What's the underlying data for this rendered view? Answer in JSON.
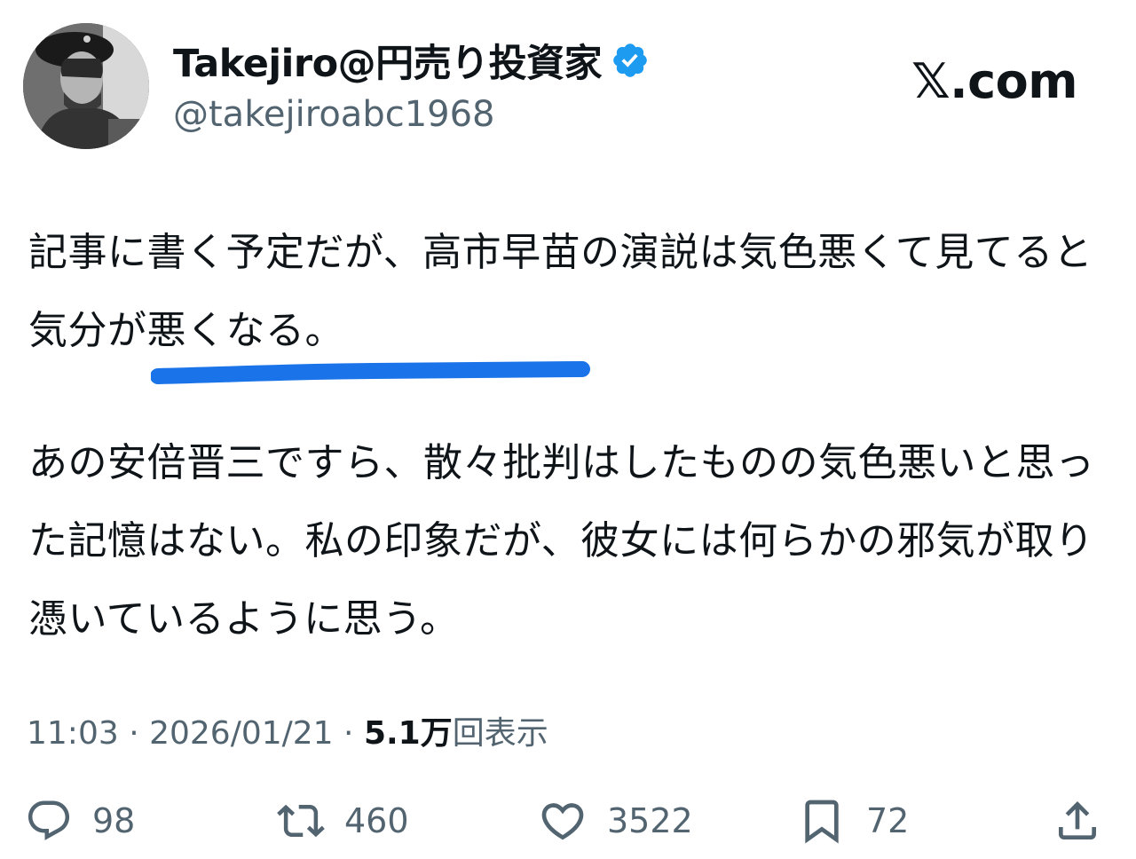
{
  "author": {
    "display_name": "Takejiro@円売り投資家",
    "handle": "@takejiroabc1968",
    "verified": true,
    "verified_color": "#1d9bf0"
  },
  "brand": "𝕏.com",
  "tweet": {
    "paragraphs": [
      "記事に書く予定だが、高市早苗の演説は気色悪くて見てると気分が悪くなる。",
      "あの安倍晋三ですら、散々批判はしたものの気色悪いと思った記憶はない。私の印象だが、彼女には何らかの邪気が取り憑いているように思う。"
    ],
    "highlight_color": "#1a73e8"
  },
  "meta": {
    "time": "11:03",
    "separator": " · ",
    "date": "2026/01/21",
    "views_count": "5.1万",
    "views_label": "回表示"
  },
  "actions": {
    "reply": {
      "icon": "reply-icon",
      "count": "98"
    },
    "retweet": {
      "icon": "retweet-icon",
      "count": "460"
    },
    "like": {
      "icon": "heart-icon",
      "count": "3522"
    },
    "bookmark": {
      "icon": "bookmark-icon",
      "count": "72"
    },
    "share": {
      "icon": "share-icon"
    }
  },
  "colors": {
    "text_primary": "#0f1419",
    "text_secondary": "#536471"
  }
}
